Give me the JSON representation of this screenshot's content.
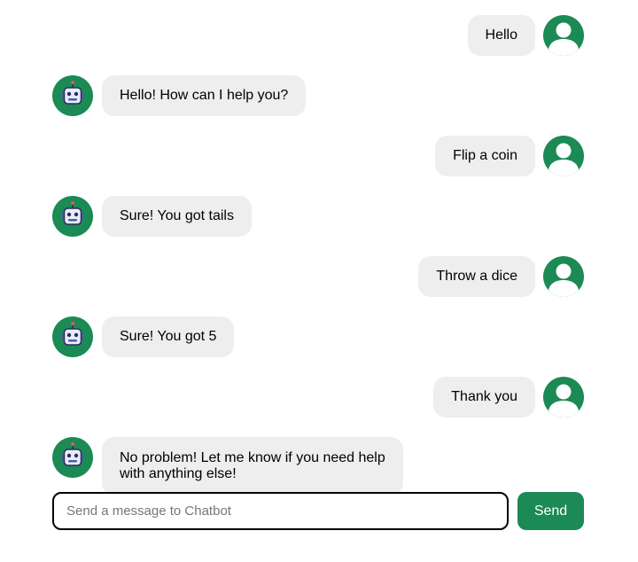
{
  "colors": {
    "accent": "#1b8a55",
    "bubble": "#eeeeee",
    "background": "#ffffff"
  },
  "messages": [
    {
      "sender": "user",
      "text": "Hello",
      "avatar_icon": "user-icon"
    },
    {
      "sender": "bot",
      "text": "Hello! How can I help you?",
      "avatar_icon": "robot-icon"
    },
    {
      "sender": "user",
      "text": "Flip a coin",
      "avatar_icon": "user-icon"
    },
    {
      "sender": "bot",
      "text": "Sure! You got tails",
      "avatar_icon": "robot-icon"
    },
    {
      "sender": "user",
      "text": "Throw a dice",
      "avatar_icon": "user-icon"
    },
    {
      "sender": "bot",
      "text": "Sure! You got 5",
      "avatar_icon": "robot-icon"
    },
    {
      "sender": "user",
      "text": "Thank you",
      "avatar_icon": "user-icon"
    },
    {
      "sender": "bot",
      "text": "No problem! Let me know if you need help with anything else!",
      "avatar_icon": "robot-icon"
    }
  ],
  "composer": {
    "placeholder": "Send a message to Chatbot",
    "value": "",
    "send_label": "Send"
  }
}
